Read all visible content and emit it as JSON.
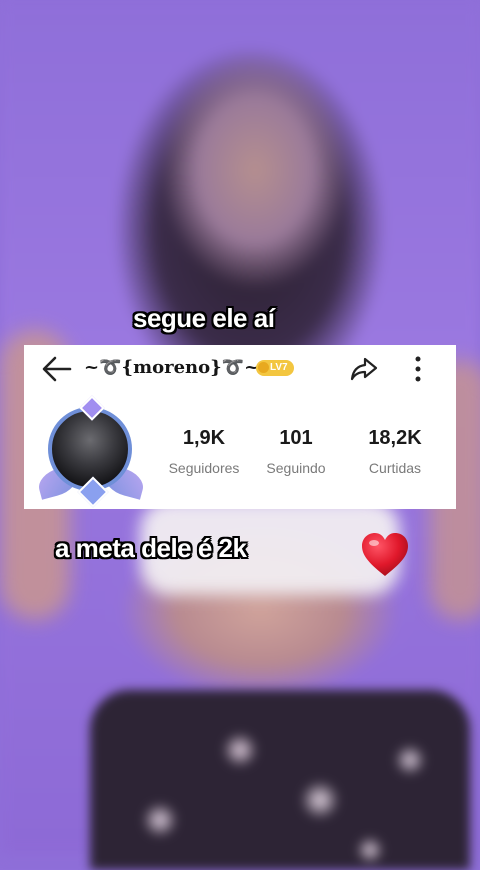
{
  "captions": {
    "top": "segue ele aí",
    "bottom": "a meta dele é 2k"
  },
  "profile": {
    "username": "~➰{moreno}➰~",
    "level_badge": "LV7",
    "stats": [
      {
        "value": "1,9K",
        "label": "Seguidores"
      },
      {
        "value": "101",
        "label": "Seguindo"
      },
      {
        "value": "18,2K",
        "label": "Curtidas"
      }
    ]
  },
  "icons": {
    "back": "back-arrow-icon",
    "share": "share-icon",
    "more": "more-vertical-icon",
    "heart": "heart-emoji-icon"
  },
  "colors": {
    "background": "#8f6fd9",
    "heart": "#e0182b",
    "badge": "#f3c640"
  }
}
